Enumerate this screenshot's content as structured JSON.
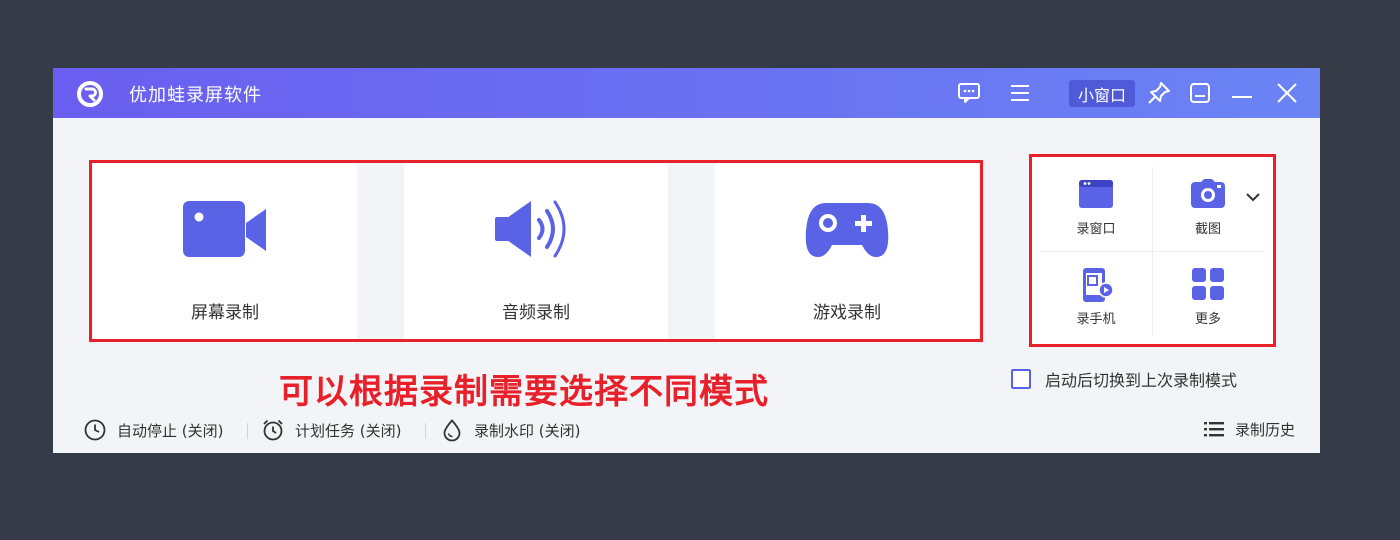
{
  "window": {
    "title": "优加蛙录屏软件",
    "mini_window_label": "小窗口"
  },
  "modes": [
    {
      "label": "屏幕录制",
      "icon": "video-camera-icon"
    },
    {
      "label": "音频录制",
      "icon": "speaker-icon"
    },
    {
      "label": "游戏录制",
      "icon": "gamepad-icon"
    }
  ],
  "quick_tools": [
    {
      "label": "录窗口",
      "icon": "window-icon"
    },
    {
      "label": "截图",
      "icon": "camera-icon"
    },
    {
      "label": "录手机",
      "icon": "phone-icon"
    },
    {
      "label": "更多",
      "icon": "grid-icon"
    }
  ],
  "annotation": "可以根据录制需要选择不同模式",
  "startup_option": {
    "label": "启动后切换到上次录制模式",
    "checked": false
  },
  "statusbar": {
    "auto_stop": "自动停止 (关闭)",
    "scheduled_task": "计划任务 (关闭)",
    "watermark": "录制水印 (关闭)",
    "history": "录制历史"
  },
  "colors": {
    "accent": "#5a63e6",
    "titlebar_start": "#6a5ef0",
    "titlebar_end": "#6a84f4",
    "annotation_red": "#e8202a",
    "background": "#353b47"
  }
}
